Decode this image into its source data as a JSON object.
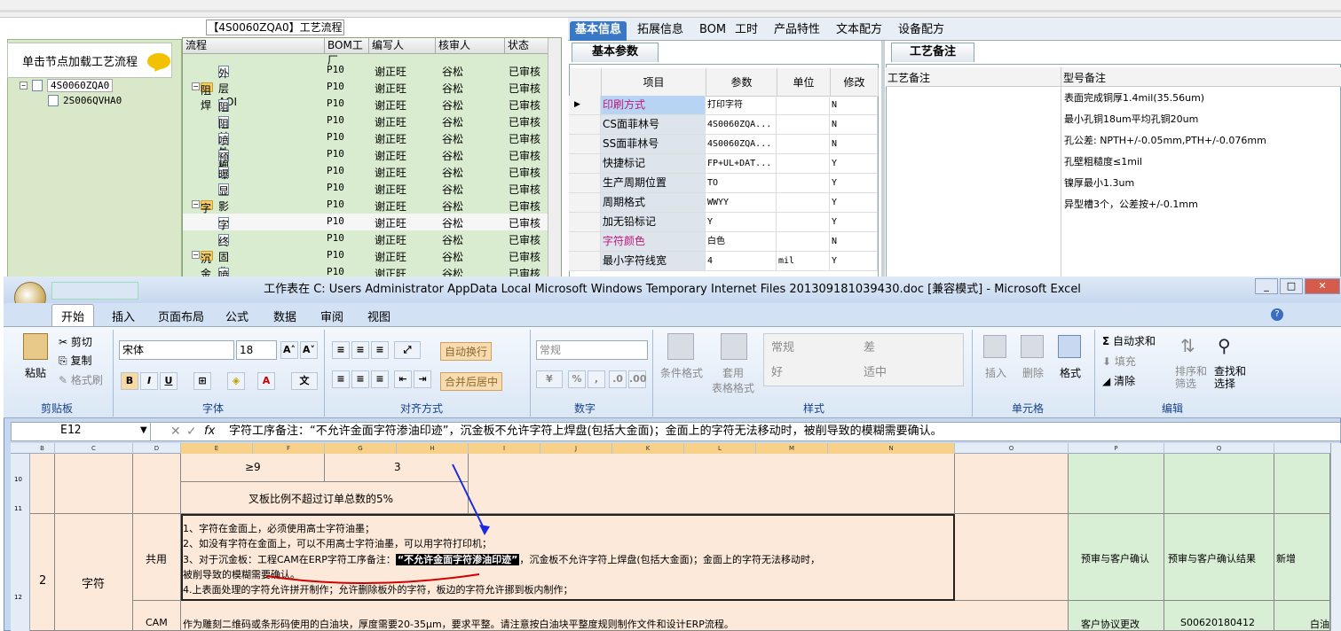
{
  "process_panel": {
    "title": "【4S0060ZQA0】工艺流程",
    "headers": [
      "流程",
      "BOM工厂",
      "编写人",
      "核审人",
      "状态"
    ],
    "rows": [
      {
        "name": "外层AOI",
        "bom": "P10",
        "writer": "谢正旺",
        "reviewer": "谷松",
        "status": "已审核",
        "level": 2
      },
      {
        "name": "阻焊",
        "bom": "P10",
        "writer": "谢正旺",
        "reviewer": "谷松",
        "status": "已审核",
        "level": 1
      },
      {
        "name": "阻焊前处理",
        "bom": "P10",
        "writer": "谢正旺",
        "reviewer": "谷松",
        "status": "已审核",
        "level": 2
      },
      {
        "name": "阻焊塞孔",
        "bom": "P10",
        "writer": "谢正旺",
        "reviewer": "谷松",
        "status": "已审核",
        "level": 2
      },
      {
        "name": "喷涂",
        "bom": "P10",
        "writer": "谢正旺",
        "reviewer": "谷松",
        "status": "已审核",
        "level": 2
      },
      {
        "name": "预烘",
        "bom": "P10",
        "writer": "谢正旺",
        "reviewer": "谷松",
        "status": "已审核",
        "level": 2
      },
      {
        "name": "曝光",
        "bom": "P10",
        "writer": "谢正旺",
        "reviewer": "谷松",
        "status": "已审核",
        "level": 2
      },
      {
        "name": "显影",
        "bom": "P10",
        "writer": "谢正旺",
        "reviewer": "谷松",
        "status": "已审核",
        "level": 2
      },
      {
        "name": "字符",
        "bom": "P10",
        "writer": "谢正旺",
        "reviewer": "谷松",
        "status": "已审核",
        "level": 1
      },
      {
        "name": "字符",
        "bom": "P10",
        "writer": "谢正旺",
        "reviewer": "谷松",
        "status": "已审核",
        "level": 2
      },
      {
        "name": "终固化",
        "bom": "P10",
        "writer": "谢正旺",
        "reviewer": "谷松",
        "status": "已审核",
        "level": 2
      },
      {
        "name": "沉金",
        "bom": "P10",
        "writer": "谢正旺",
        "reviewer": "谷松",
        "status": "已审核",
        "level": 1
      },
      {
        "name": "喷砂",
        "bom": "P10",
        "writer": "谢正旺",
        "reviewer": "谷松",
        "status": "已审核",
        "level": 2
      }
    ]
  },
  "left_tree": {
    "load_button": "单击节点加载工艺流程",
    "nodes": [
      "4S0060ZQA0",
      "2S006QVHA0"
    ]
  },
  "right_tabs": [
    "基本信息",
    "拓展信息",
    "BOM",
    "工时",
    "产品特性",
    "文本配方",
    "设备配方"
  ],
  "basic_params": {
    "tab": "基本参数",
    "headers": [
      "项目",
      "参数",
      "单位",
      "修改"
    ],
    "rows": [
      {
        "item": "印刷方式",
        "value": "打印字符",
        "unit": "",
        "mod": "N",
        "pink": true
      },
      {
        "item": "CS面菲林号",
        "value": "4S0060ZQA...",
        "unit": "",
        "mod": "N",
        "pink": false
      },
      {
        "item": "SS面菲林号",
        "value": "4S0060ZQA...",
        "unit": "",
        "mod": "N",
        "pink": false
      },
      {
        "item": "快捷标记",
        "value": "FP+UL+DAT...",
        "unit": "",
        "mod": "Y",
        "pink": false
      },
      {
        "item": "生产周期位置",
        "value": "TO",
        "unit": "",
        "mod": "Y",
        "pink": false
      },
      {
        "item": "周期格式",
        "value": "WWYY",
        "unit": "",
        "mod": "Y",
        "pink": false
      },
      {
        "item": "加无铅标记",
        "value": "Y",
        "unit": "",
        "mod": "Y",
        "pink": false
      },
      {
        "item": "字符颜色",
        "value": "白色",
        "unit": "",
        "mod": "N",
        "pink": true
      },
      {
        "item": "最小字符线宽",
        "value": "4",
        "unit": "mil",
        "mod": "Y",
        "pink": false
      }
    ]
  },
  "process_notes": {
    "tab": "工艺备注",
    "headers": [
      "工艺备注",
      "型号备注"
    ],
    "lines": [
      "表面完成铜厚1.4mil(35.56um)",
      "最小孔铜18um平均孔铜20um",
      "孔公差: NPTH+/-0.05mm,PTH+/-0.076mm",
      "孔壁粗糙度≤1mil",
      "镍厚最小1.3um",
      "异型槽3个，公差按+/-0.1mm"
    ]
  },
  "excel": {
    "title": "工作表在 C: Users Administrator AppData Local Microsoft Windows Temporary Internet Files 201309181039430.doc [兼容模式] - Microsoft Excel",
    "menu_tabs": [
      "开始",
      "插入",
      "页面布局",
      "公式",
      "数据",
      "审阅",
      "视图"
    ],
    "clipboard": {
      "paste": "粘贴",
      "cut": "剪切",
      "copy": "复制",
      "format_painter": "格式刷",
      "label": "剪贴板"
    },
    "font": {
      "name": "宋体",
      "size": "18",
      "label": "字体"
    },
    "alignment": {
      "wrap": "自动换行",
      "merge": "合并后居中",
      "label": "对齐方式"
    },
    "number": {
      "format": "常规",
      "label": "数字"
    },
    "styles": {
      "cond": "条件格式",
      "table": "套用\n表格格式",
      "normal": "常规",
      "bad": "差",
      "good": "好",
      "neutral": "适中",
      "label": "样式"
    },
    "cells": {
      "insert": "插入",
      "delete": "删除",
      "format": "格式",
      "label": "单元格"
    },
    "editing": {
      "autosum": "自动求和",
      "fill": "填充",
      "clear": "清除",
      "sort": "排序和\n筛选",
      "find": "查找和\n选择",
      "label": "编辑"
    },
    "name_box": "E12",
    "formula": "字符工序备注：“不允许金面字符渗油印迹”，沉金板不允许字符上焊盘(包括大金面)；金面上的字符无法移动时，被削导致的模糊需要确认。",
    "columns": [
      "B",
      "C",
      "D",
      "E",
      "F",
      "G",
      "H",
      "I",
      "J",
      "K",
      "L",
      "M",
      "N",
      "O",
      "P",
      "Q"
    ],
    "rows": [
      "10",
      "11",
      "12"
    ],
    "cells_data": {
      "ge9": "≥9",
      "three": "3",
      "ratio": "叉板比例不超过订单总数的5%",
      "row_no": "2",
      "category": "字符",
      "shared": "共用",
      "cam": "CAM",
      "line1": "1、字符在金面上，必须使用高士字符油墨；",
      "line2": "2、如没有字符在金面上，可以不用高士字符油墨，可以用字符打印机；",
      "line3a": "3、对于沉金板：工程CAM在ERP字符工序备注：",
      "line3q": "“不允许金面字符渗油印迹”",
      "line3b": "，沉金板不允许字符上焊盘(包括大金面)；金面上的字符无法移动时，",
      "line3c": "被削导致的模糊需要确认。",
      "line4": "4.上表面处理的字符允许拼开制作；允许删除板外的字符，板边的字符允许挪到板内制作；",
      "p_cell": "预审与客户确认",
      "q_cell": "预审与客户确认结果",
      "r_cell": "新增",
      "cam_text": "作为雕刻二维码或条形码使用的白油块，厚度需要20-35μm，要求平整。请注意按白油块平整度规则制作文件和设计ERP流程。",
      "p_cam": "客户协议更改",
      "q_cam": "S00620180412",
      "r_cam": "白油"
    }
  }
}
